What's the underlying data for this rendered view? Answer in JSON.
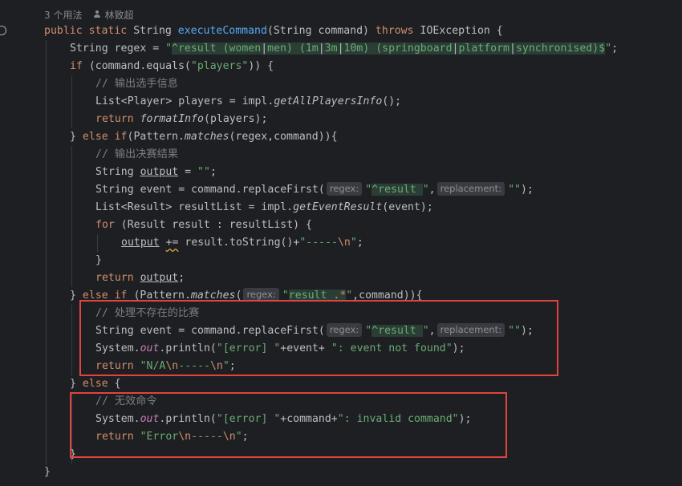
{
  "meta": {
    "usages": "3 个用法",
    "author": "林致超"
  },
  "code": {
    "l1": {
      "kw1": "public",
      "kw2": "static",
      "type": "String",
      "fn": "executeCommand",
      "params": "(String command) ",
      "kw3": "throws",
      "exc": " IOException {"
    },
    "l2": {
      "pre": "String regex = ",
      "q1": "\"",
      "r1": "^result (",
      "r2": "women",
      "r3": "|",
      "r4": "men",
      "r5": ") (",
      "r6": "1m",
      "r7": "|",
      "r8": "3m",
      "r9": "|",
      "r10": "10m",
      "r11": ") (",
      "r12": "springboard",
      "r13": "|",
      "r14": "platform",
      "r15": "|",
      "r16": "synchronised",
      "r17": ")$",
      "q2": "\"",
      "post": ";"
    },
    "l3": {
      "kw": "if",
      "pre": " (command.equals(",
      "str": "\"players\"",
      "post": ")) {"
    },
    "l4": {
      "cm": "// 输出选手信息"
    },
    "l5": {
      "pre": "List<Player> players = impl.",
      "it": "getAllPlayersInfo",
      "post": "();"
    },
    "l6": {
      "kw": "return",
      "sp": " ",
      "it": "formatInfo",
      "post": "(players);"
    },
    "l7": {
      "pre": "} ",
      "kw1": "else",
      "sp": " ",
      "kw2": "if",
      "mid": "(Pattern.",
      "it": "matches",
      "post": "(regex,command)){"
    },
    "l8": {
      "cm": "// 输出决赛结果"
    },
    "l9": {
      "pre": "String ",
      "var": "output",
      "mid": " = ",
      "str": "\"\"",
      "post": ";"
    },
    "l10": {
      "pre": "String event = command.replaceFirst(",
      "hint1": "regex:",
      "q1": "\"",
      "rx": "^result ",
      "q2": "\"",
      "comma": ",",
      "hint2": "replacement:",
      "str2": "\"\"",
      "post": ");"
    },
    "l11": {
      "pre": "List<Result> resultList = impl.",
      "it": "getEventResult",
      "post": "(event);"
    },
    "l12": {
      "kw": "for",
      "post": " (Result result : resultList) {"
    },
    "l13": {
      "var": "output",
      "sp": " ",
      "op": "+=",
      "mid": " result.toString()+",
      "str": "\"-----",
      "esc": "\\n",
      "q": "\"",
      "post": ";"
    },
    "l14": {
      "text": "}"
    },
    "l15": {
      "kw": "return",
      "sp": " ",
      "var": "output",
      "post": ";"
    },
    "l16": {
      "pre": "} ",
      "kw1": "else",
      "sp": " ",
      "kw2": "if",
      "mid": " (Pattern.",
      "it": "matches",
      "paren": "(",
      "hint": "regex:",
      "q1": "\"",
      "rx1": "result ",
      "rx2": ".*",
      "q2": "\"",
      "post": ",command)){"
    },
    "l17": {
      "cm": "// 处理不存在的比赛"
    },
    "l18": {
      "pre": "String event = command.replaceFirst(",
      "hint1": "regex:",
      "q1": "\"",
      "rx": "^result ",
      "q2": "\"",
      "comma": ",",
      "hint2": "replacement:",
      "str2": "\"\"",
      "post": ");"
    },
    "l19": {
      "pre": "System.",
      "sf": "out",
      "mid": ".println(",
      "s1": "\"[error] \"",
      "mid2": "+event+ ",
      "s2": "\": event not found\"",
      "post": ");"
    },
    "l20": {
      "kw": "return",
      "sp": " ",
      "s1": "\"N/A",
      "e1": "\\n",
      "s2": "-----",
      "e2": "\\n",
      "q": "\"",
      "post": ";"
    },
    "l21": {
      "pre": "} ",
      "kw": "else",
      "post": " {"
    },
    "l22": {
      "cm": "// 无效命令"
    },
    "l23": {
      "pre": "System.",
      "sf": "out",
      "mid": ".println(",
      "s1": "\"[error] \"",
      "mid2": "+command+",
      "s2": "\": invalid command\"",
      "post": ");"
    },
    "l24": {
      "kw": "return",
      "sp": " ",
      "s1": "\"Error",
      "e1": "\\n",
      "s2": "-----",
      "e2": "\\n",
      "q": "\"",
      "post": ";"
    },
    "l25": {
      "text": "}"
    },
    "l26": {
      "text": "}"
    }
  },
  "colors": {
    "background": "#1e1f22",
    "keyword": "#cf8e6d",
    "function": "#56a8f5",
    "string": "#6aab73",
    "comment": "#7a7e85",
    "static_field": "#c77dbb",
    "highlight_box": "#e0443e"
  }
}
